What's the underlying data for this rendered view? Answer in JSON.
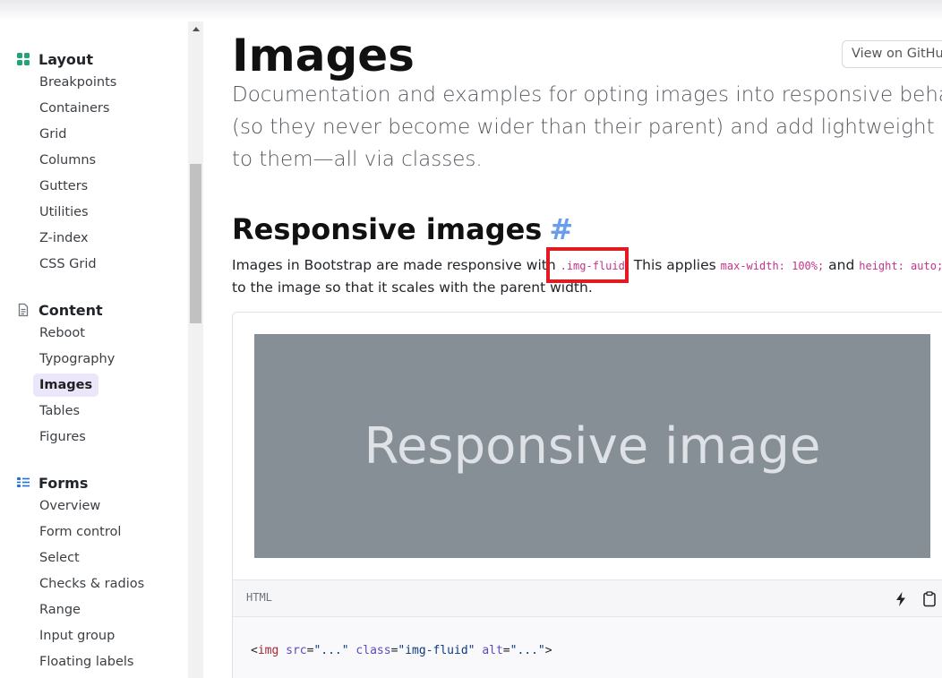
{
  "sidebar": {
    "groups": [
      {
        "title": "Layout",
        "icon": "grid-icon",
        "items": [
          "Breakpoints",
          "Containers",
          "Grid",
          "Columns",
          "Gutters",
          "Utilities",
          "Z-index",
          "CSS Grid"
        ]
      },
      {
        "title": "Content",
        "icon": "document-icon",
        "items": [
          "Reboot",
          "Typography",
          "Images",
          "Tables",
          "Figures"
        ],
        "active": "Images"
      },
      {
        "title": "Forms",
        "icon": "list-check-icon",
        "items": [
          "Overview",
          "Form control",
          "Select",
          "Checks & radios",
          "Range",
          "Input group",
          "Floating labels"
        ]
      }
    ]
  },
  "main": {
    "title": "Images",
    "github_button": "View on GitHub",
    "lead_lines": [
      "Documentation and examples for opting images into responsive behavior",
      "(so they never become wider than their parent) and add lightweight styles",
      "to them—all via classes."
    ],
    "section_title": "Responsive images",
    "section_anchor": "#",
    "para": {
      "t1": "Images in Bootstrap are made responsive with ",
      "c1": ".img-fluid",
      "t2": ". This applies ",
      "c2": "max-width: 100%;",
      "t3": " and ",
      "c3": "height: auto;",
      "line2": "to the image so that it scales with the parent width."
    },
    "example": {
      "placeholder_text": "Responsive image",
      "code_lang": "HTML",
      "code": {
        "open": "<",
        "tag": "img",
        "attr1": "src",
        "val1": "\"...\"",
        "attr2": "class",
        "val2": "\"img-fluid\"",
        "attr3": "alt",
        "val3": "\"...\"",
        "close": ">"
      }
    }
  },
  "colors": {
    "accent": "#6b9eea",
    "highlight_box": "#e11b22",
    "active_nav_bg": "#ece6fb",
    "placeholder_bg": "#868e96",
    "inline_code": "#c3348a"
  }
}
